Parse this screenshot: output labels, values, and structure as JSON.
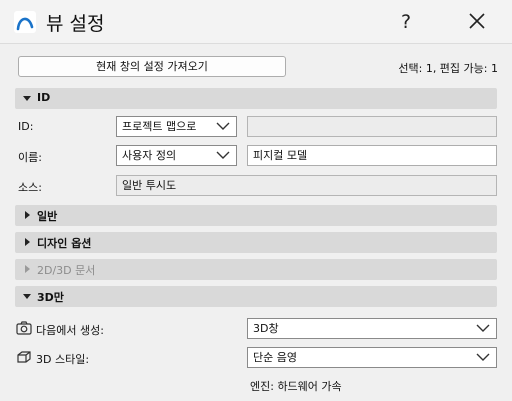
{
  "window": {
    "title": "뷰 설정",
    "help_glyph": "?"
  },
  "toolbar": {
    "import_label": "현재 창의 설정 가져오기",
    "selection_info": "선택: 1, 편집 가능: 1"
  },
  "sections": {
    "id": "ID",
    "general": "일반",
    "design_options": "디자인 옵션",
    "docs_2d3d": "2D/3D 문서",
    "only_3d": "3D만"
  },
  "id_section": {
    "id_label": "ID:",
    "id_combo": "프로젝트 맵으로",
    "id_value": "",
    "name_label": "이름:",
    "name_combo": "사용자 정의",
    "name_value": "피지컬 모델",
    "source_label": "소스:",
    "source_value": "일반 투시도"
  },
  "only3d": {
    "generate_label": "다음에서 생성:",
    "generate_value": "3D창",
    "style_label": "3D 스타일:",
    "style_value": "단순 음영",
    "engine_text": "엔진: 하드웨어 가속"
  },
  "icons": {
    "app": "archicad-arc-icon",
    "close": "close-icon",
    "camera": "camera-icon",
    "cube": "cube-icon",
    "expanded": "triangle-down-icon",
    "collapsed": "triangle-right-icon",
    "dropdown": "chevron-down-icon"
  },
  "colors": {
    "accent": "#1a73c9",
    "section_bg": "#d9d9d9",
    "disabled_text": "#8c8c8c"
  }
}
